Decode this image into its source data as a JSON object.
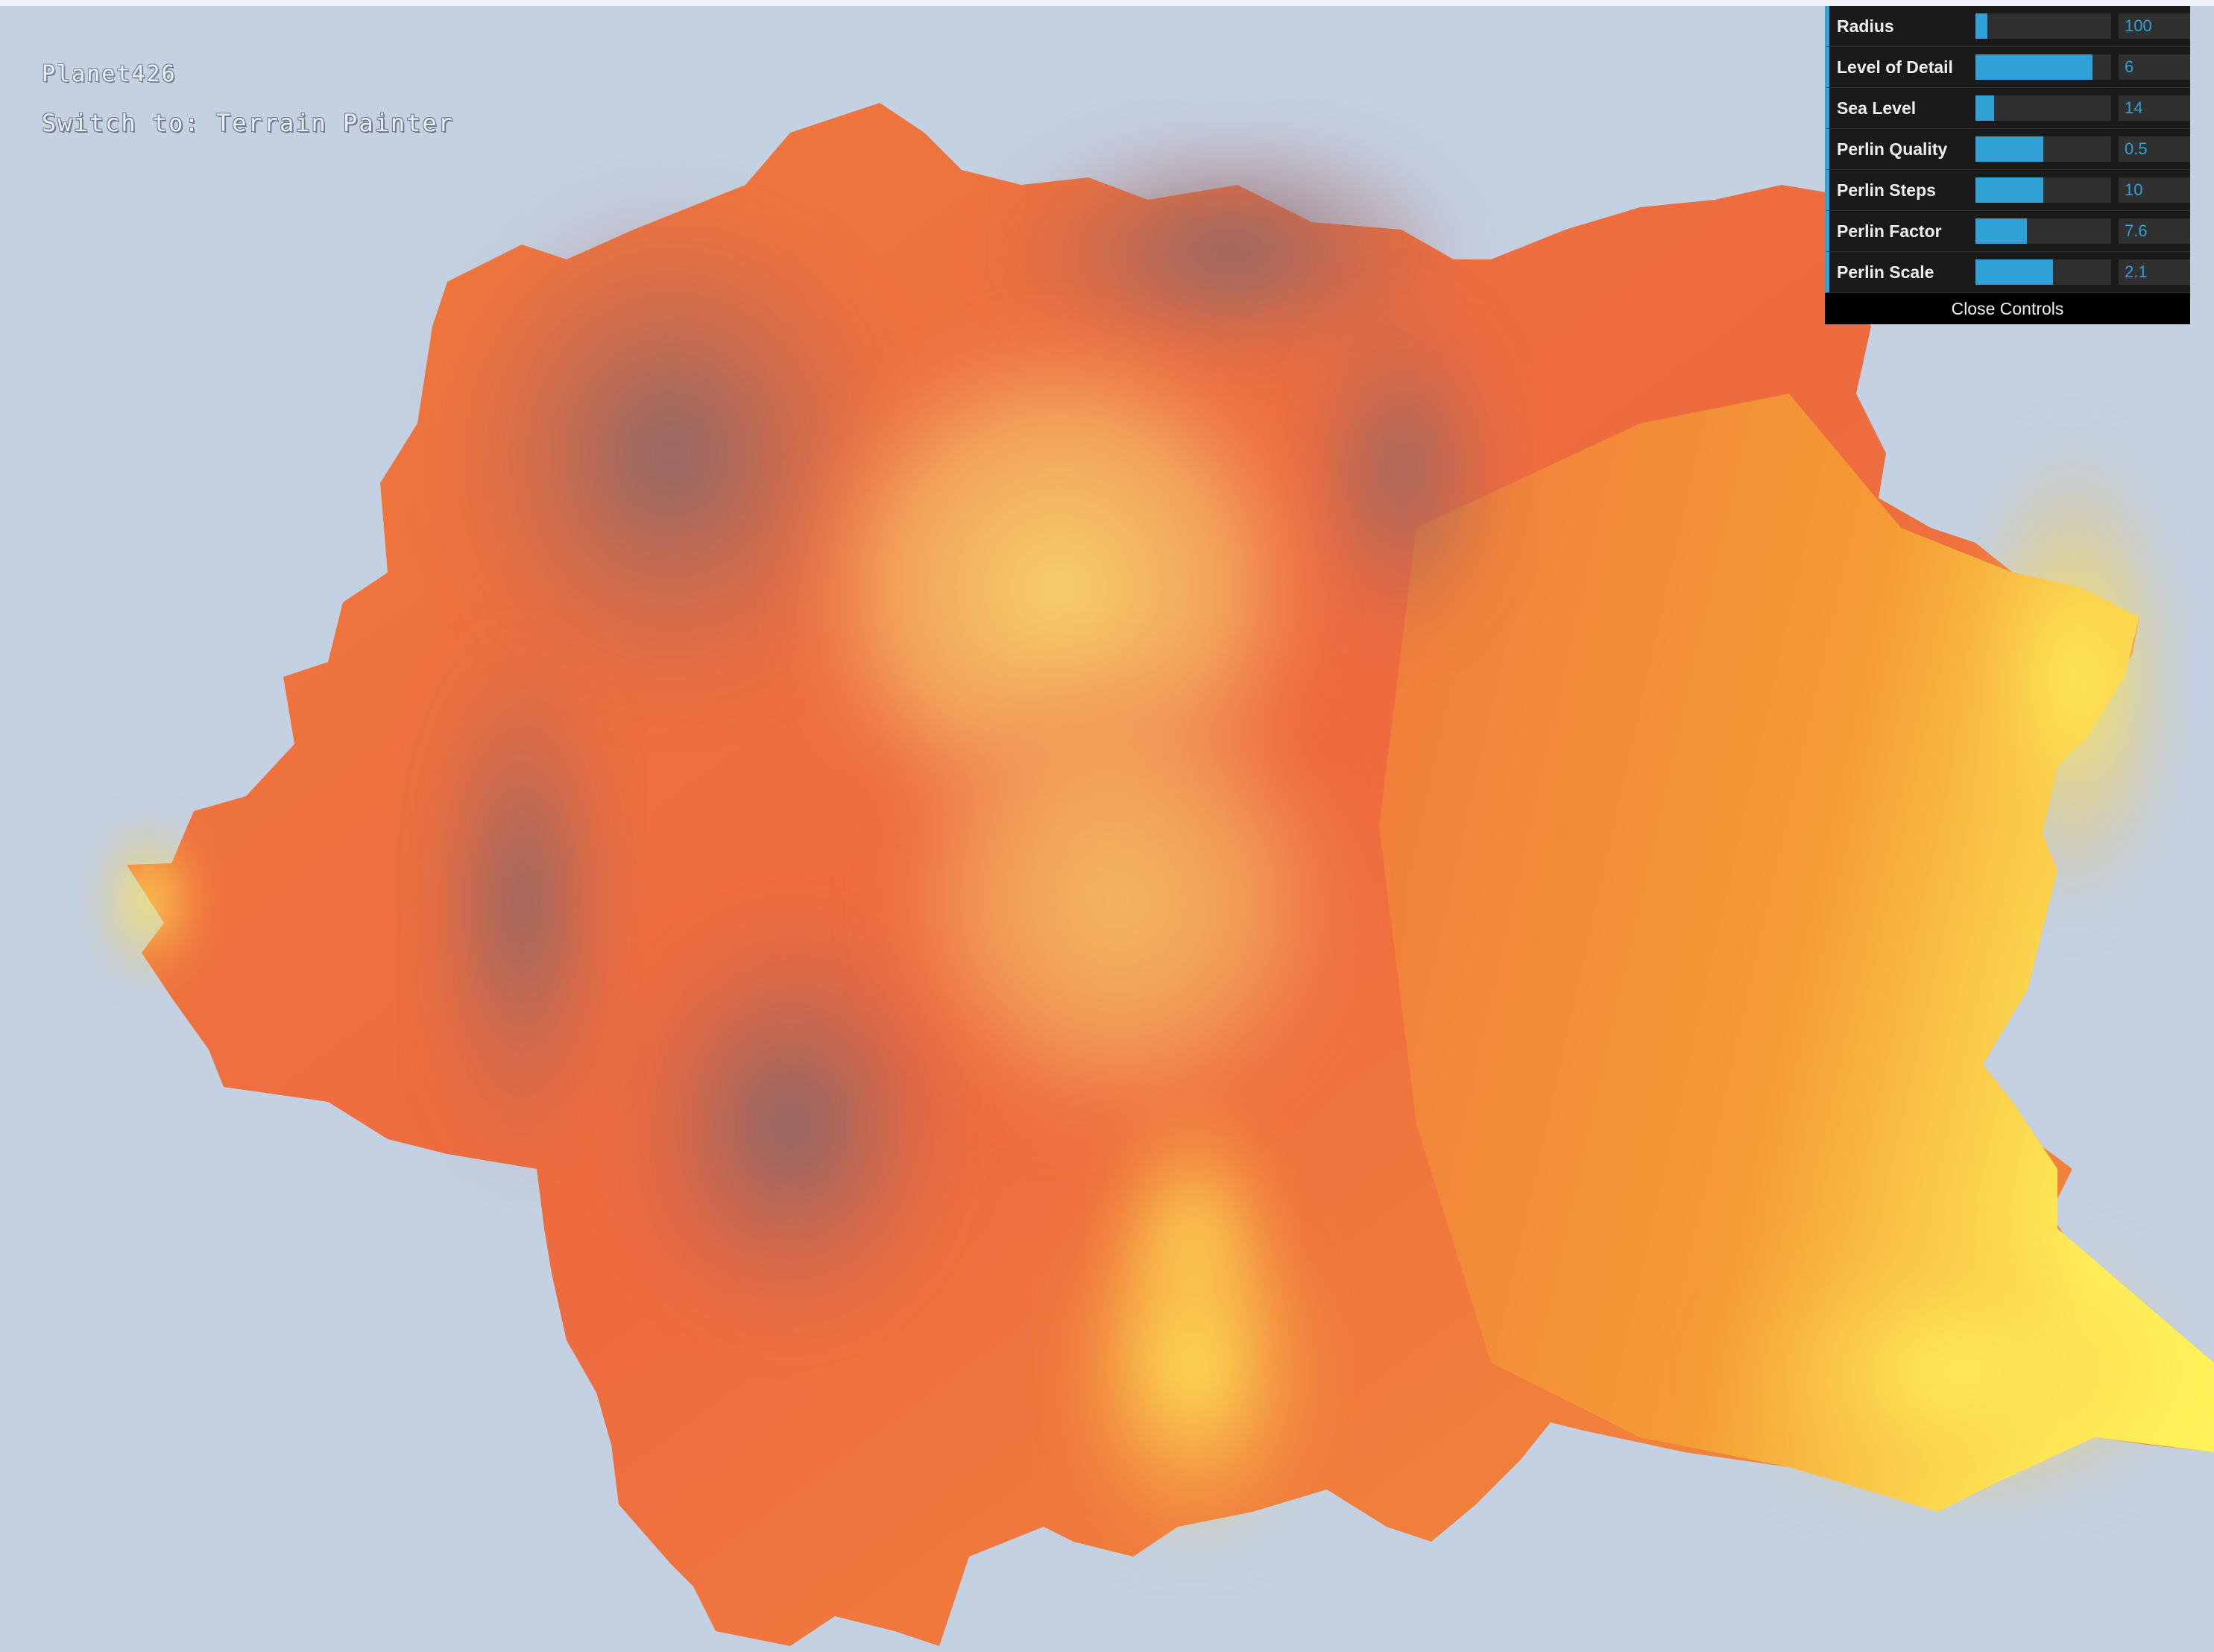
{
  "app": {
    "title": "Planet426",
    "switch_prefix": "Switch to: ",
    "switch_target": "Terrain Painter"
  },
  "controls": {
    "rows": [
      {
        "label": "Radius",
        "value": "100",
        "fill": 0.09
      },
      {
        "label": "Level of Detail",
        "value": "6",
        "fill": 0.86
      },
      {
        "label": "Sea Level",
        "value": "14",
        "fill": 0.14
      },
      {
        "label": "Perlin Quality",
        "value": "0.5",
        "fill": 0.5
      },
      {
        "label": "Perlin Steps",
        "value": "10",
        "fill": 0.5
      },
      {
        "label": "Perlin Factor",
        "value": "7.6",
        "fill": 0.38
      },
      {
        "label": "Perlin Scale",
        "value": "2.1",
        "fill": 0.57
      }
    ],
    "close_label": "Close Controls"
  },
  "colors": {
    "background": "#c3d1e3",
    "panel": "#1a1a1a",
    "accent": "#2fa1d6",
    "terrain_low": "#e8553a",
    "terrain_mid": "#f39a34",
    "terrain_high": "#fff55a",
    "terrain_shadow": "#7d6a70"
  }
}
